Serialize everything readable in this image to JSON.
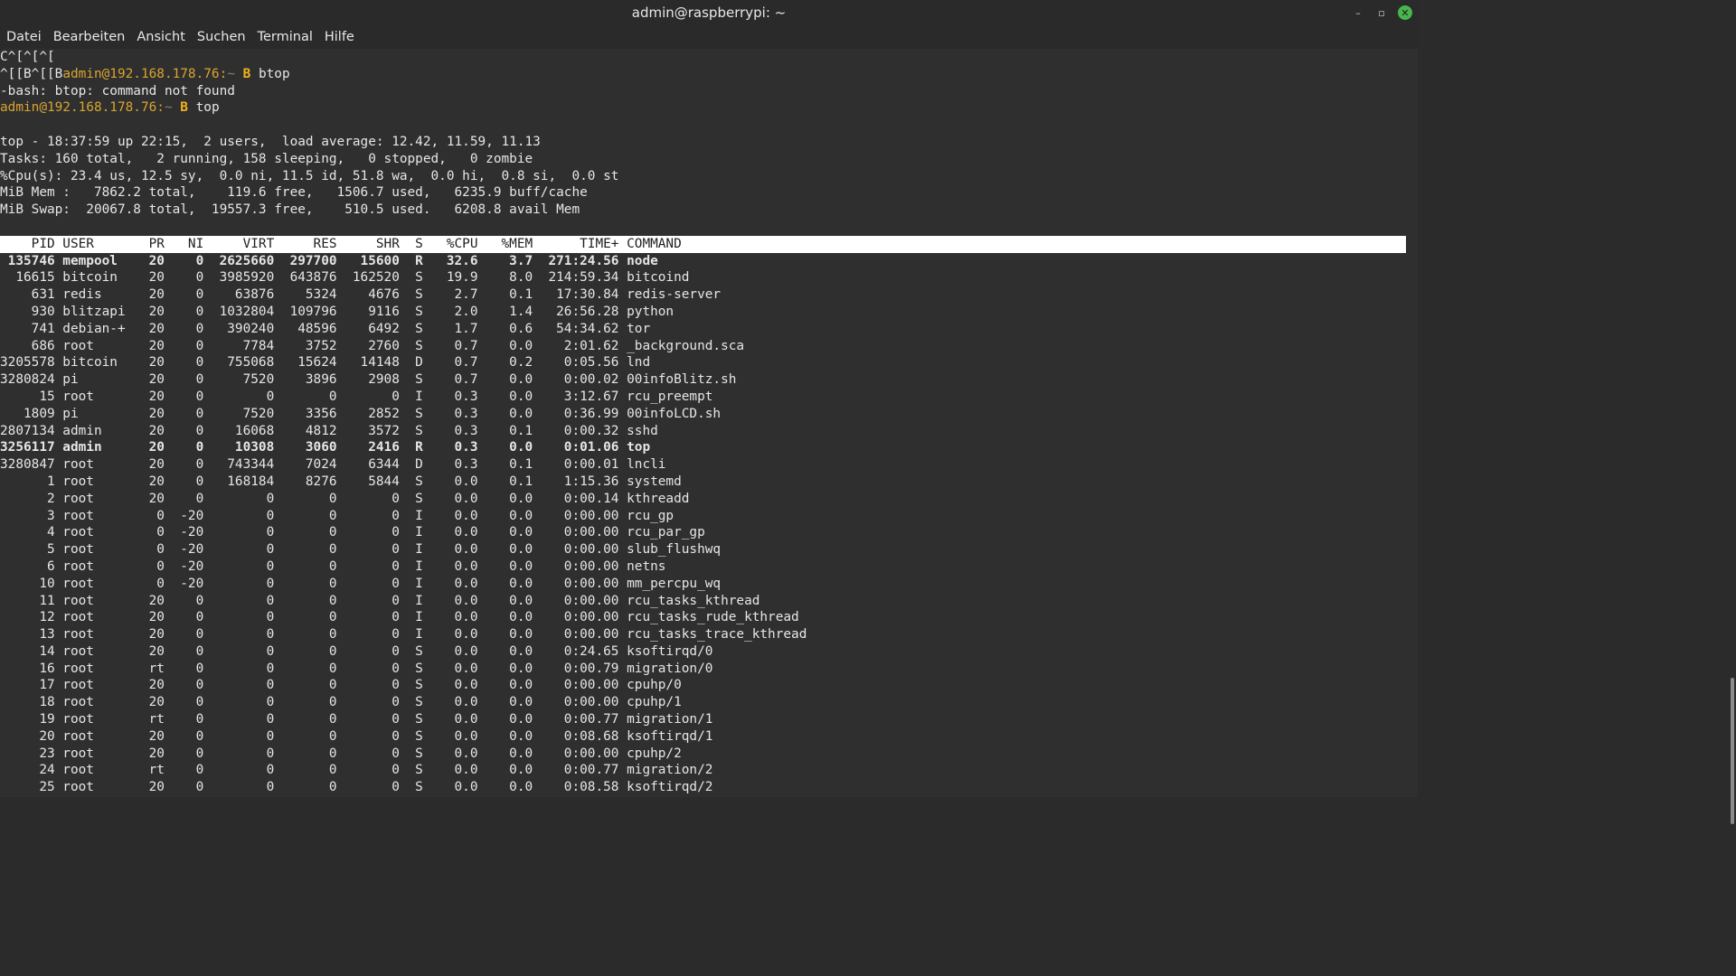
{
  "window": {
    "title": "admin@raspberrypi: ~",
    "controls": {
      "minimize": "–",
      "maximize": "▫",
      "close": "✕"
    }
  },
  "menu": [
    "Datei",
    "Bearbeiten",
    "Ansicht",
    "Suchen",
    "Terminal",
    "Hilfe"
  ],
  "terminal": {
    "pre_lines": [
      {
        "kind": "plain",
        "text": "C^[^[^["
      },
      {
        "kind": "prompt",
        "prefix": "^[[B^[[B",
        "user": "admin@192.168.178.76:",
        "path": "~",
        "symbol": "B",
        "cmd": "btop"
      },
      {
        "kind": "plain",
        "text": "-bash: btop: command not found"
      },
      {
        "kind": "prompt",
        "prefix": "",
        "user": "admin@192.168.178.76:",
        "path": "~",
        "symbol": "B",
        "cmd": "top"
      },
      {
        "kind": "plain",
        "text": ""
      }
    ],
    "summary": [
      "top - 18:37:59 up 22:15,  2 users,  load average: 12.42, 11.59, 11.13",
      "Tasks: 160 total,   2 running, 158 sleeping,   0 stopped,   0 zombie",
      "%Cpu(s): 23.4 us, 12.5 sy,  0.0 ni, 11.5 id, 51.8 wa,  0.0 hi,  0.8 si,  0.0 st",
      "MiB Mem :   7862.2 total,    119.6 free,   1506.7 used,   6235.9 buff/cache",
      "MiB Swap:  20067.8 total,  19557.3 free,    510.5 used.   6208.8 avail Mem",
      ""
    ],
    "columns": [
      "PID",
      "USER",
      "PR",
      "NI",
      "VIRT",
      "RES",
      "SHR",
      "S",
      "%CPU",
      "%MEM",
      "TIME+",
      "COMMAND"
    ],
    "processes": [
      {
        "pid": "135746",
        "user": "mempool",
        "pr": "20",
        "ni": "0",
        "virt": "2625660",
        "res": "297700",
        "shr": "15600",
        "s": "R",
        "cpu": "32.6",
        "mem": "3.7",
        "time": "271:24.56",
        "cmd": "node",
        "bold": true
      },
      {
        "pid": "16615",
        "user": "bitcoin",
        "pr": "20",
        "ni": "0",
        "virt": "3985920",
        "res": "643876",
        "shr": "162520",
        "s": "S",
        "cpu": "19.9",
        "mem": "8.0",
        "time": "214:59.34",
        "cmd": "bitcoind",
        "bold": false
      },
      {
        "pid": "631",
        "user": "redis",
        "pr": "20",
        "ni": "0",
        "virt": "63876",
        "res": "5324",
        "shr": "4676",
        "s": "S",
        "cpu": "2.7",
        "mem": "0.1",
        "time": "17:30.84",
        "cmd": "redis-server",
        "bold": false
      },
      {
        "pid": "930",
        "user": "blitzapi",
        "pr": "20",
        "ni": "0",
        "virt": "1032804",
        "res": "109796",
        "shr": "9116",
        "s": "S",
        "cpu": "2.0",
        "mem": "1.4",
        "time": "26:56.28",
        "cmd": "python",
        "bold": false
      },
      {
        "pid": "741",
        "user": "debian-+",
        "pr": "20",
        "ni": "0",
        "virt": "390240",
        "res": "48596",
        "shr": "6492",
        "s": "S",
        "cpu": "1.7",
        "mem": "0.6",
        "time": "54:34.62",
        "cmd": "tor",
        "bold": false
      },
      {
        "pid": "686",
        "user": "root",
        "pr": "20",
        "ni": "0",
        "virt": "7784",
        "res": "3752",
        "shr": "2760",
        "s": "S",
        "cpu": "0.7",
        "mem": "0.0",
        "time": "2:01.62",
        "cmd": "_background.sca",
        "bold": false
      },
      {
        "pid": "3205578",
        "user": "bitcoin",
        "pr": "20",
        "ni": "0",
        "virt": "755068",
        "res": "15624",
        "shr": "14148",
        "s": "D",
        "cpu": "0.7",
        "mem": "0.2",
        "time": "0:05.56",
        "cmd": "lnd",
        "bold": false
      },
      {
        "pid": "3280824",
        "user": "pi",
        "pr": "20",
        "ni": "0",
        "virt": "7520",
        "res": "3896",
        "shr": "2908",
        "s": "S",
        "cpu": "0.7",
        "mem": "0.0",
        "time": "0:00.02",
        "cmd": "00infoBlitz.sh",
        "bold": false
      },
      {
        "pid": "15",
        "user": "root",
        "pr": "20",
        "ni": "0",
        "virt": "0",
        "res": "0",
        "shr": "0",
        "s": "I",
        "cpu": "0.3",
        "mem": "0.0",
        "time": "3:12.67",
        "cmd": "rcu_preempt",
        "bold": false
      },
      {
        "pid": "1809",
        "user": "pi",
        "pr": "20",
        "ni": "0",
        "virt": "7520",
        "res": "3356",
        "shr": "2852",
        "s": "S",
        "cpu": "0.3",
        "mem": "0.0",
        "time": "0:36.99",
        "cmd": "00infoLCD.sh",
        "bold": false
      },
      {
        "pid": "2807134",
        "user": "admin",
        "pr": "20",
        "ni": "0",
        "virt": "16068",
        "res": "4812",
        "shr": "3572",
        "s": "S",
        "cpu": "0.3",
        "mem": "0.1",
        "time": "0:00.32",
        "cmd": "sshd",
        "bold": false
      },
      {
        "pid": "3256117",
        "user": "admin",
        "pr": "20",
        "ni": "0",
        "virt": "10308",
        "res": "3060",
        "shr": "2416",
        "s": "R",
        "cpu": "0.3",
        "mem": "0.0",
        "time": "0:01.06",
        "cmd": "top",
        "bold": true
      },
      {
        "pid": "3280847",
        "user": "root",
        "pr": "20",
        "ni": "0",
        "virt": "743344",
        "res": "7024",
        "shr": "6344",
        "s": "D",
        "cpu": "0.3",
        "mem": "0.1",
        "time": "0:00.01",
        "cmd": "lncli",
        "bold": false
      },
      {
        "pid": "1",
        "user": "root",
        "pr": "20",
        "ni": "0",
        "virt": "168184",
        "res": "8276",
        "shr": "5844",
        "s": "S",
        "cpu": "0.0",
        "mem": "0.1",
        "time": "1:15.36",
        "cmd": "systemd",
        "bold": false
      },
      {
        "pid": "2",
        "user": "root",
        "pr": "20",
        "ni": "0",
        "virt": "0",
        "res": "0",
        "shr": "0",
        "s": "S",
        "cpu": "0.0",
        "mem": "0.0",
        "time": "0:00.14",
        "cmd": "kthreadd",
        "bold": false
      },
      {
        "pid": "3",
        "user": "root",
        "pr": "0",
        "ni": "-20",
        "virt": "0",
        "res": "0",
        "shr": "0",
        "s": "I",
        "cpu": "0.0",
        "mem": "0.0",
        "time": "0:00.00",
        "cmd": "rcu_gp",
        "bold": false
      },
      {
        "pid": "4",
        "user": "root",
        "pr": "0",
        "ni": "-20",
        "virt": "0",
        "res": "0",
        "shr": "0",
        "s": "I",
        "cpu": "0.0",
        "mem": "0.0",
        "time": "0:00.00",
        "cmd": "rcu_par_gp",
        "bold": false
      },
      {
        "pid": "5",
        "user": "root",
        "pr": "0",
        "ni": "-20",
        "virt": "0",
        "res": "0",
        "shr": "0",
        "s": "I",
        "cpu": "0.0",
        "mem": "0.0",
        "time": "0:00.00",
        "cmd": "slub_flushwq",
        "bold": false
      },
      {
        "pid": "6",
        "user": "root",
        "pr": "0",
        "ni": "-20",
        "virt": "0",
        "res": "0",
        "shr": "0",
        "s": "I",
        "cpu": "0.0",
        "mem": "0.0",
        "time": "0:00.00",
        "cmd": "netns",
        "bold": false
      },
      {
        "pid": "10",
        "user": "root",
        "pr": "0",
        "ni": "-20",
        "virt": "0",
        "res": "0",
        "shr": "0",
        "s": "I",
        "cpu": "0.0",
        "mem": "0.0",
        "time": "0:00.00",
        "cmd": "mm_percpu_wq",
        "bold": false
      },
      {
        "pid": "11",
        "user": "root",
        "pr": "20",
        "ni": "0",
        "virt": "0",
        "res": "0",
        "shr": "0",
        "s": "I",
        "cpu": "0.0",
        "mem": "0.0",
        "time": "0:00.00",
        "cmd": "rcu_tasks_kthread",
        "bold": false
      },
      {
        "pid": "12",
        "user": "root",
        "pr": "20",
        "ni": "0",
        "virt": "0",
        "res": "0",
        "shr": "0",
        "s": "I",
        "cpu": "0.0",
        "mem": "0.0",
        "time": "0:00.00",
        "cmd": "rcu_tasks_rude_kthread",
        "bold": false
      },
      {
        "pid": "13",
        "user": "root",
        "pr": "20",
        "ni": "0",
        "virt": "0",
        "res": "0",
        "shr": "0",
        "s": "I",
        "cpu": "0.0",
        "mem": "0.0",
        "time": "0:00.00",
        "cmd": "rcu_tasks_trace_kthread",
        "bold": false
      },
      {
        "pid": "14",
        "user": "root",
        "pr": "20",
        "ni": "0",
        "virt": "0",
        "res": "0",
        "shr": "0",
        "s": "S",
        "cpu": "0.0",
        "mem": "0.0",
        "time": "0:24.65",
        "cmd": "ksoftirqd/0",
        "bold": false
      },
      {
        "pid": "16",
        "user": "root",
        "pr": "rt",
        "ni": "0",
        "virt": "0",
        "res": "0",
        "shr": "0",
        "s": "S",
        "cpu": "0.0",
        "mem": "0.0",
        "time": "0:00.79",
        "cmd": "migration/0",
        "bold": false
      },
      {
        "pid": "17",
        "user": "root",
        "pr": "20",
        "ni": "0",
        "virt": "0",
        "res": "0",
        "shr": "0",
        "s": "S",
        "cpu": "0.0",
        "mem": "0.0",
        "time": "0:00.00",
        "cmd": "cpuhp/0",
        "bold": false
      },
      {
        "pid": "18",
        "user": "root",
        "pr": "20",
        "ni": "0",
        "virt": "0",
        "res": "0",
        "shr": "0",
        "s": "S",
        "cpu": "0.0",
        "mem": "0.0",
        "time": "0:00.00",
        "cmd": "cpuhp/1",
        "bold": false
      },
      {
        "pid": "19",
        "user": "root",
        "pr": "rt",
        "ni": "0",
        "virt": "0",
        "res": "0",
        "shr": "0",
        "s": "S",
        "cpu": "0.0",
        "mem": "0.0",
        "time": "0:00.77",
        "cmd": "migration/1",
        "bold": false
      },
      {
        "pid": "20",
        "user": "root",
        "pr": "20",
        "ni": "0",
        "virt": "0",
        "res": "0",
        "shr": "0",
        "s": "S",
        "cpu": "0.0",
        "mem": "0.0",
        "time": "0:08.68",
        "cmd": "ksoftirqd/1",
        "bold": false
      },
      {
        "pid": "23",
        "user": "root",
        "pr": "20",
        "ni": "0",
        "virt": "0",
        "res": "0",
        "shr": "0",
        "s": "S",
        "cpu": "0.0",
        "mem": "0.0",
        "time": "0:00.00",
        "cmd": "cpuhp/2",
        "bold": false
      },
      {
        "pid": "24",
        "user": "root",
        "pr": "rt",
        "ni": "0",
        "virt": "0",
        "res": "0",
        "shr": "0",
        "s": "S",
        "cpu": "0.0",
        "mem": "0.0",
        "time": "0:00.77",
        "cmd": "migration/2",
        "bold": false
      },
      {
        "pid": "25",
        "user": "root",
        "pr": "20",
        "ni": "0",
        "virt": "0",
        "res": "0",
        "shr": "0",
        "s": "S",
        "cpu": "0.0",
        "mem": "0.0",
        "time": "0:08.58",
        "cmd": "ksoftirqd/2",
        "bold": false
      }
    ]
  }
}
